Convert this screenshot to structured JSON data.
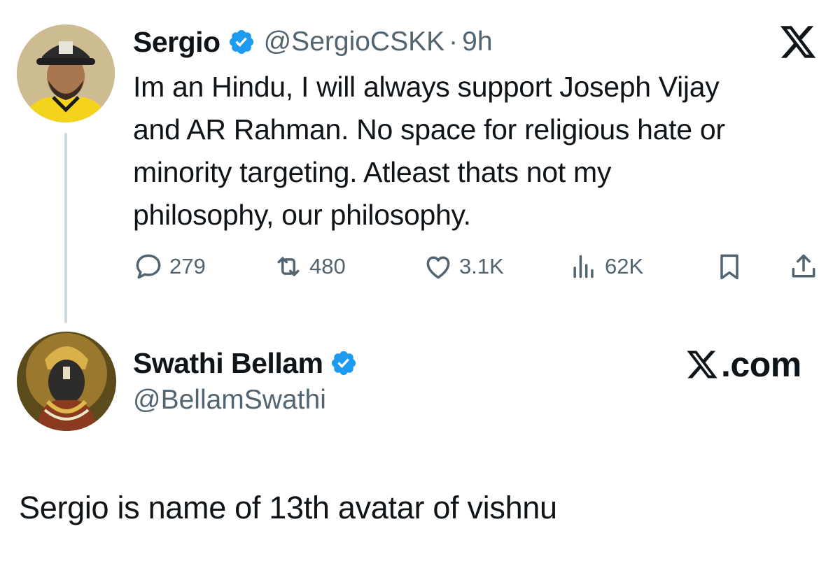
{
  "tweet1": {
    "name": "Sergio",
    "handle": "@SergioCSKK",
    "separator": "·",
    "time": "9h",
    "text": "Im an Hindu, I will always support Joseph Vijay\nand AR Rahman. No space for religious hate or\nminority targeting. Atleast thats not my\nphilosophy, our philosophy.",
    "stats": {
      "replies": "279",
      "reposts": "480",
      "likes": "3.1K",
      "views": "62K"
    }
  },
  "tweet2": {
    "name": "Swathi Bellam",
    "handle": "@BellamSwathi",
    "brand": ".com",
    "text": "Sergio is name of 13th avatar of vishnu"
  },
  "colors": {
    "verified": "#1d9bf0",
    "secondary_text": "#536471",
    "thread_line": "#cfd9de",
    "text": "#0f1419"
  },
  "icons": [
    "verified-badge-icon",
    "x-logo-icon",
    "reply-icon",
    "repost-icon",
    "like-icon",
    "views-icon",
    "bookmark-icon",
    "share-icon"
  ]
}
